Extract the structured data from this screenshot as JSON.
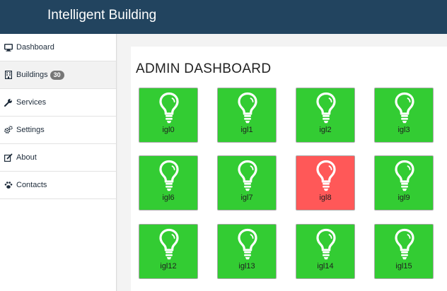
{
  "app": {
    "title": "Intelligent Building"
  },
  "sidebar": {
    "items": [
      {
        "label": "Dashboard",
        "icon": "monitor-icon"
      },
      {
        "label": "Buildings",
        "icon": "building-icon",
        "badge": "30"
      },
      {
        "label": "Services",
        "icon": "wrench-icon"
      },
      {
        "label": "Settings",
        "icon": "gears-icon"
      },
      {
        "label": "About",
        "icon": "edit-icon"
      },
      {
        "label": "Contacts",
        "icon": "paw-icon"
      }
    ]
  },
  "main": {
    "title": "ADMIN DASHBOARD",
    "tiles": [
      {
        "label": "igl0",
        "status": "on"
      },
      {
        "label": "igl1",
        "status": "on"
      },
      {
        "label": "igl2",
        "status": "on"
      },
      {
        "label": "igl3",
        "status": "on"
      },
      {
        "label": "igl6",
        "status": "on"
      },
      {
        "label": "igl7",
        "status": "on"
      },
      {
        "label": "igl8",
        "status": "off"
      },
      {
        "label": "igl9",
        "status": "on"
      },
      {
        "label": "igl12",
        "status": "on"
      },
      {
        "label": "igl13",
        "status": "on"
      },
      {
        "label": "igl14",
        "status": "on"
      },
      {
        "label": "igl15",
        "status": "on"
      }
    ]
  },
  "colors": {
    "header": "#22445f",
    "tile_on": "#33cc33",
    "tile_off": "#ff5858",
    "bulb": "#ffffff"
  }
}
